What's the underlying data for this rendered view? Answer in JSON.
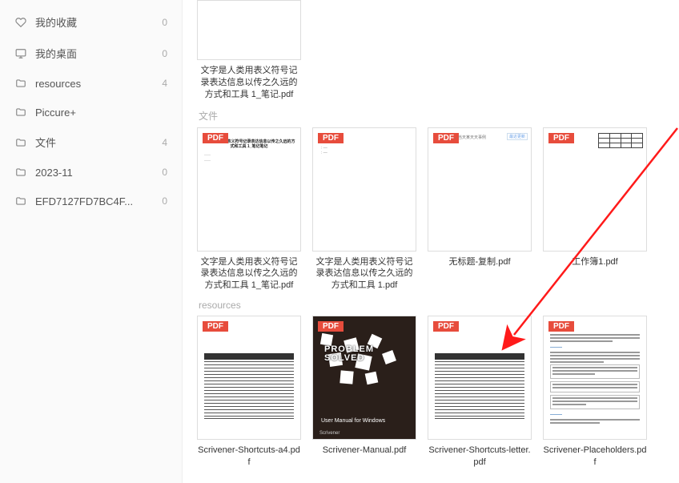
{
  "sidebar": {
    "items": [
      {
        "label": "我的收藏",
        "count": "0",
        "icon": "heart"
      },
      {
        "label": "我的桌面",
        "count": "0",
        "icon": "desktop"
      },
      {
        "label": "resources",
        "count": "4",
        "icon": "folder"
      },
      {
        "label": "Piccure+",
        "count": "",
        "icon": "folder"
      },
      {
        "label": "文件",
        "count": "4",
        "icon": "folder"
      },
      {
        "label": "2023-11",
        "count": "0",
        "icon": "folder"
      },
      {
        "label": "EFD7127FD7BC4F...",
        "count": "0",
        "icon": "folder"
      }
    ]
  },
  "sections": {
    "top_item": {
      "name": "文字是人类用表义符号记录表达信息以传之久远的方式和工具 1_笔记.pdf"
    },
    "files_title": "文件",
    "files": [
      {
        "name": "文字是人类用表义符号记录表达信息以传之久远的方式和工具 1_笔记.pdf",
        "badge": "PDF",
        "variant": "titled"
      },
      {
        "name": "文字是人类用表义符号记录表达信息以传之久远的方式和工具 1.pdf",
        "badge": "PDF",
        "variant": "sparse"
      },
      {
        "name": "无标题-复制.pdf",
        "badge": "PDF",
        "variant": "chip"
      },
      {
        "name": "工作簿1.pdf",
        "badge": "PDF",
        "variant": "minitable"
      }
    ],
    "resources_title": "resources",
    "resources": [
      {
        "name": "Scrivener-Shortcuts-a4.pdf",
        "badge": "PDF",
        "variant": "bigtable"
      },
      {
        "name": "Scrivener-Manual.pdf",
        "badge": "PDF",
        "variant": "manual",
        "manual_text": "User Manual\nfor Windows",
        "manual_brand": "Scrivener",
        "manual_title": "PROBLEM SOLVED"
      },
      {
        "name": "Scrivener-Shortcuts-letter.pdf",
        "badge": "PDF",
        "variant": "bigtable"
      },
      {
        "name": "Scrivener-Placeholders.pdf",
        "badge": "PDF",
        "variant": "placeholders"
      }
    ]
  },
  "misc": {
    "chip_text": "最近更新",
    "tiny_note": "，当天某天天事例",
    "titled_doc_header": "文字是人类用表义符号记录表达信息以传之久远的方式和工具 1_笔记笔记"
  }
}
